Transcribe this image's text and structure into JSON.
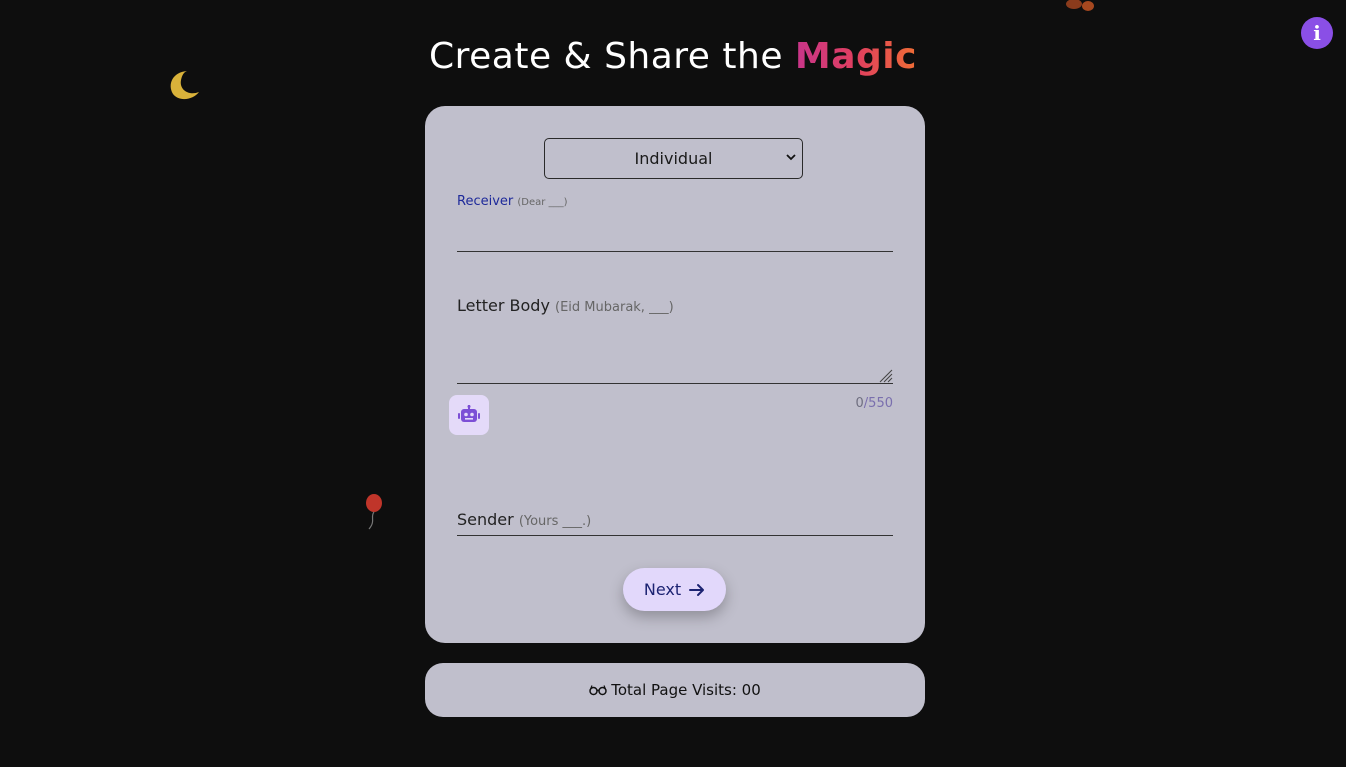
{
  "header": {
    "title_prefix": "Create & Share the ",
    "title_highlight": "Magic"
  },
  "info_button": {
    "label": "i"
  },
  "form": {
    "type_select": {
      "value": "Individual"
    },
    "receiver": {
      "label": "Receiver",
      "hint": "(Dear ___)"
    },
    "letter_body": {
      "label": "Letter Body",
      "hint": "(Eid Mubarak, ___)"
    },
    "counter": {
      "current": "0",
      "max": "/550"
    },
    "sender": {
      "label": "Sender",
      "hint": "(Yours ___.)"
    },
    "next_button": {
      "label": "Next"
    }
  },
  "footer": {
    "visits_text": "Total Page Visits: 00"
  },
  "colors": {
    "background": "#0e0e0e",
    "card": "#c0bfcc",
    "accent": "#8a4fe6",
    "button": "#e2d8fb",
    "receiver_label": "#1e2a9a"
  },
  "icons": [
    "moon-icon",
    "balloon-icon",
    "sparkle-icon",
    "leaf-icon",
    "info-icon",
    "robot-icon",
    "arrow-right-icon",
    "glasses-icon",
    "chevron-down-icon",
    "resize-handle-icon"
  ]
}
